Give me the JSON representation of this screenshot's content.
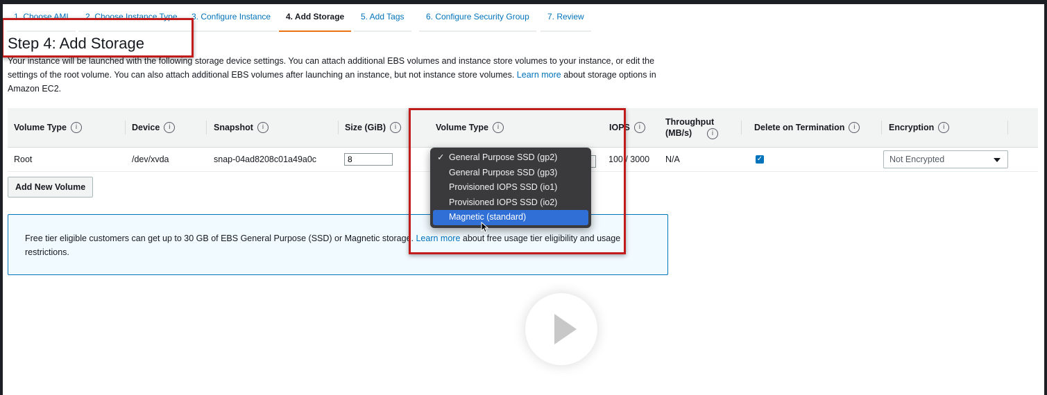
{
  "wizard": {
    "steps": [
      {
        "label": "1. Choose AMI"
      },
      {
        "label": "2. Choose Instance Type"
      },
      {
        "label": "3. Configure Instance"
      },
      {
        "label": "4. Add Storage"
      },
      {
        "label": "5. Add Tags"
      },
      {
        "label": "6. Configure Security Group"
      },
      {
        "label": "7. Review"
      }
    ],
    "active_step": 4
  },
  "page": {
    "title": "Step 4: Add Storage",
    "desc_part1": "Your instance will be launched with the following storage device settings. You can attach additional EBS volumes and instance store volumes to your instance, or edit the settings of the root volume. You can also attach additional EBS volumes after launching an instance, but not instance store volumes.",
    "desc_link": "Learn more",
    "desc_part2": "about storage options in Amazon EC2."
  },
  "table": {
    "headers": {
      "volume_type": "Volume Type",
      "device": "Device",
      "snapshot": "Snapshot",
      "size": "Size (GiB)",
      "vol_type": "Volume Type",
      "iops": "IOPS",
      "throughput": "Throughput (MB/s)",
      "delete_on_termination": "Delete on Termination",
      "encryption": "Encryption"
    },
    "info_glyph": "i",
    "row": {
      "volume_type": "Root",
      "device": "/dev/xvda",
      "snapshot": "snap-04ad8208c01a49a0c",
      "size": "8",
      "iops": "100 / 3000",
      "throughput": "N/A",
      "delete_on_termination": true,
      "encryption": "Not Encrypted"
    }
  },
  "add_button": "Add New Volume",
  "free_tier": {
    "text1": "Free tier eligible customers can get up to 30 GB of EBS General Purpose (SSD) or Magnetic storage.",
    "link": "Learn more",
    "text2": "about free usage tier eligibility and usage restrictions."
  },
  "volume_dropdown": {
    "selected": "General Purpose SSD (gp2)",
    "highlighted": "Magnetic (standard)",
    "check_glyph": "✓",
    "options": [
      "General Purpose SSD (gp2)",
      "General Purpose SSD (gp3)",
      "Provisioned IOPS SSD (io1)",
      "Provisioned IOPS SSD (io2)",
      "Magnetic (standard)"
    ]
  },
  "colors": {
    "link": "#0073bb",
    "active_tab": "#ec7211",
    "annotation": "#c21b1b",
    "highlight": "#2f6fd6"
  },
  "icons": [
    "info-icon",
    "check-icon",
    "caret-down-icon",
    "play-icon",
    "mouse-cursor-icon"
  ]
}
